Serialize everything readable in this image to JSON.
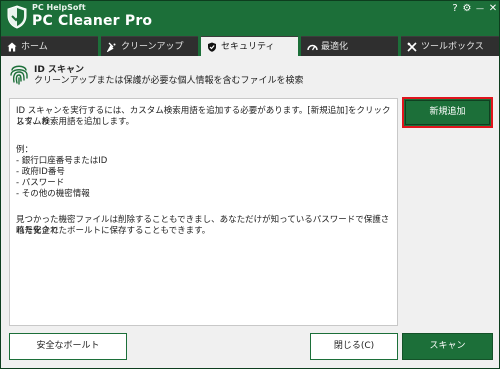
{
  "app": {
    "vendor": "PC HelpSoft",
    "name": "PC Cleaner Pro"
  },
  "titlebar": {
    "help": "?",
    "settings": "⚙",
    "minimize": "—",
    "close": "✕"
  },
  "tabs": [
    {
      "label": "ホーム",
      "icon": "home-icon"
    },
    {
      "label": "クリーンアップ",
      "icon": "cleanup-icon"
    },
    {
      "label": "セキュリティ",
      "icon": "shield-icon",
      "active": true
    },
    {
      "label": "最適化",
      "icon": "speedometer-icon"
    },
    {
      "label": "ツールボックス",
      "icon": "tools-icon"
    }
  ],
  "section": {
    "title": "ID スキャン",
    "subtitle": "クリーンアップまたは保護が必要な個人情報を含むファイルを検索"
  },
  "content": {
    "intro_line1": "ID スキャンを実行するには、カスタム検索用語を追加する必要があります。[新規追加]をクリックして、カ",
    "intro_line2": "スタム検索用語を追加します。",
    "example_heading": "例：",
    "examples": [
      "- 銀行口座番号またはID",
      "- 政府ID番号",
      "- パスワード",
      "- その他の機密情報"
    ],
    "outro_line1": "見つかった機密ファイルは削除することもできまし、あなただけが知っているパスワードで保護された安全で",
    "outro_line2": "暗号化されたボールトに保存することもできます。"
  },
  "buttons": {
    "add_new": "新規追加",
    "secure_vault": "安全なボールト",
    "close": "閉じる(C)",
    "scan": "スキャン"
  },
  "colors": {
    "brand_green": "#1c6f39",
    "tab_dark": "#2f2f2f",
    "highlight_red": "#e0141d"
  }
}
